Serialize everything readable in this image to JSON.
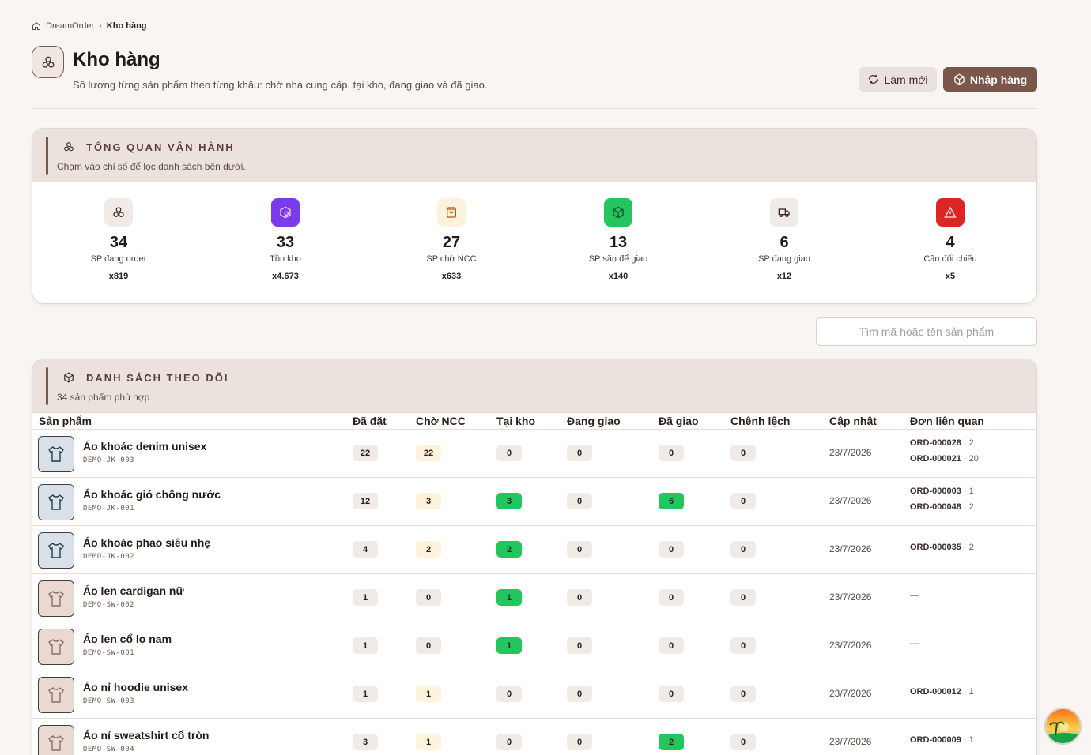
{
  "breadcrumb": {
    "root": "DreamOrder",
    "current": "Kho hàng"
  },
  "header": {
    "title": "Kho hàng",
    "subtitle": "Số lượng từng sản phẩm theo từng khâu: chờ nhà cung cấp, tại kho, đang giao và đã giao.",
    "refresh_label": "Làm mới",
    "import_label": "Nhập hàng"
  },
  "overview": {
    "title": "TỔNG QUAN VẬN HÀNH",
    "subtitle": "Chạm vào chỉ số để lọc danh sách bên dưới.",
    "metrics": [
      {
        "value": "34",
        "label": "SP đang order",
        "qty": "x819",
        "icon": "boxes-icon",
        "color": "#f1ebe8"
      },
      {
        "value": "33",
        "label": "Tồn kho",
        "qty": "x4.673",
        "icon": "warehouse-icon",
        "color": "#7c3aed"
      },
      {
        "value": "27",
        "label": "SP chờ NCC",
        "qty": "x633",
        "icon": "bag-icon",
        "color": "#fdf3dc"
      },
      {
        "value": "13",
        "label": "SP sẵn để giao",
        "qty": "x140",
        "icon": "package-icon",
        "color": "#22c55e"
      },
      {
        "value": "6",
        "label": "SP đang giao",
        "qty": "x12",
        "icon": "truck-icon",
        "color": "#f1ebe8"
      },
      {
        "value": "4",
        "label": "Cần đối chiếu",
        "qty": "x5",
        "icon": "alert-icon",
        "color": "#dc2626"
      }
    ]
  },
  "search": {
    "placeholder": "Tìm mã hoặc tên sản phẩm"
  },
  "list": {
    "title": "DANH SÁCH THEO DÕI",
    "subtitle": "34 sản phẩm phù hợp",
    "columns": [
      "Sản phẩm",
      "Đã đặt",
      "Chờ NCC",
      "Tại kho",
      "Đang giao",
      "Đã giao",
      "Chênh lệch",
      "Cập nhật",
      "Đơn liên quan"
    ],
    "rows": [
      {
        "name": "Áo khoác denim unisex",
        "code": "DEMO-JK-003",
        "thumb": "blue",
        "ordered": "22",
        "waiting": "22",
        "stock": "0",
        "shipping": "0",
        "delivered": "0",
        "diff": "0",
        "date": "23/7/2026",
        "orders": [
          {
            "id": "ORD-000028",
            "q": "· 2"
          },
          {
            "id": "ORD-000021",
            "q": "· 20"
          }
        ]
      },
      {
        "name": "Áo khoác gió chống nước",
        "code": "DEMO-JK-001",
        "thumb": "blue",
        "ordered": "12",
        "waiting": "3",
        "stock": "3",
        "shipping": "0",
        "delivered": "6",
        "diff": "0",
        "date": "23/7/2026",
        "orders": [
          {
            "id": "ORD-000003",
            "q": "· 1"
          },
          {
            "id": "ORD-000048",
            "q": "· 2"
          }
        ]
      },
      {
        "name": "Áo khoác phao siêu nhẹ",
        "code": "DEMO-JK-002",
        "thumb": "blue",
        "ordered": "4",
        "waiting": "2",
        "stock": "2",
        "shipping": "0",
        "delivered": "0",
        "diff": "0",
        "date": "23/7/2026",
        "orders": [
          {
            "id": "ORD-000035",
            "q": "· 2"
          }
        ]
      },
      {
        "name": "Áo len cardigan nữ",
        "code": "DEMO-SW-002",
        "thumb": "pink",
        "ordered": "1",
        "waiting": "0",
        "stock": "1",
        "shipping": "0",
        "delivered": "0",
        "diff": "0",
        "date": "23/7/2026",
        "orders": [],
        "no_orders": "—"
      },
      {
        "name": "Áo len cổ lọ nam",
        "code": "DEMO-SW-001",
        "thumb": "pink",
        "ordered": "1",
        "waiting": "0",
        "stock": "1",
        "shipping": "0",
        "delivered": "0",
        "diff": "0",
        "date": "23/7/2026",
        "orders": [],
        "no_orders": "—"
      },
      {
        "name": "Áo nỉ hoodie unisex",
        "code": "DEMO-SW-003",
        "thumb": "pink",
        "ordered": "1",
        "waiting": "1",
        "stock": "0",
        "shipping": "0",
        "delivered": "0",
        "diff": "0",
        "date": "23/7/2026",
        "orders": [
          {
            "id": "ORD-000012",
            "q": "· 1"
          }
        ]
      },
      {
        "name": "Áo nỉ sweatshirt cổ tròn",
        "code": "DEMO-SW-004",
        "thumb": "pink",
        "ordered": "3",
        "waiting": "1",
        "stock": "0",
        "shipping": "0",
        "delivered": "2",
        "diff": "0",
        "date": "23/7/2026",
        "orders": [
          {
            "id": "ORD-000009",
            "q": "· 1"
          }
        ]
      }
    ]
  }
}
